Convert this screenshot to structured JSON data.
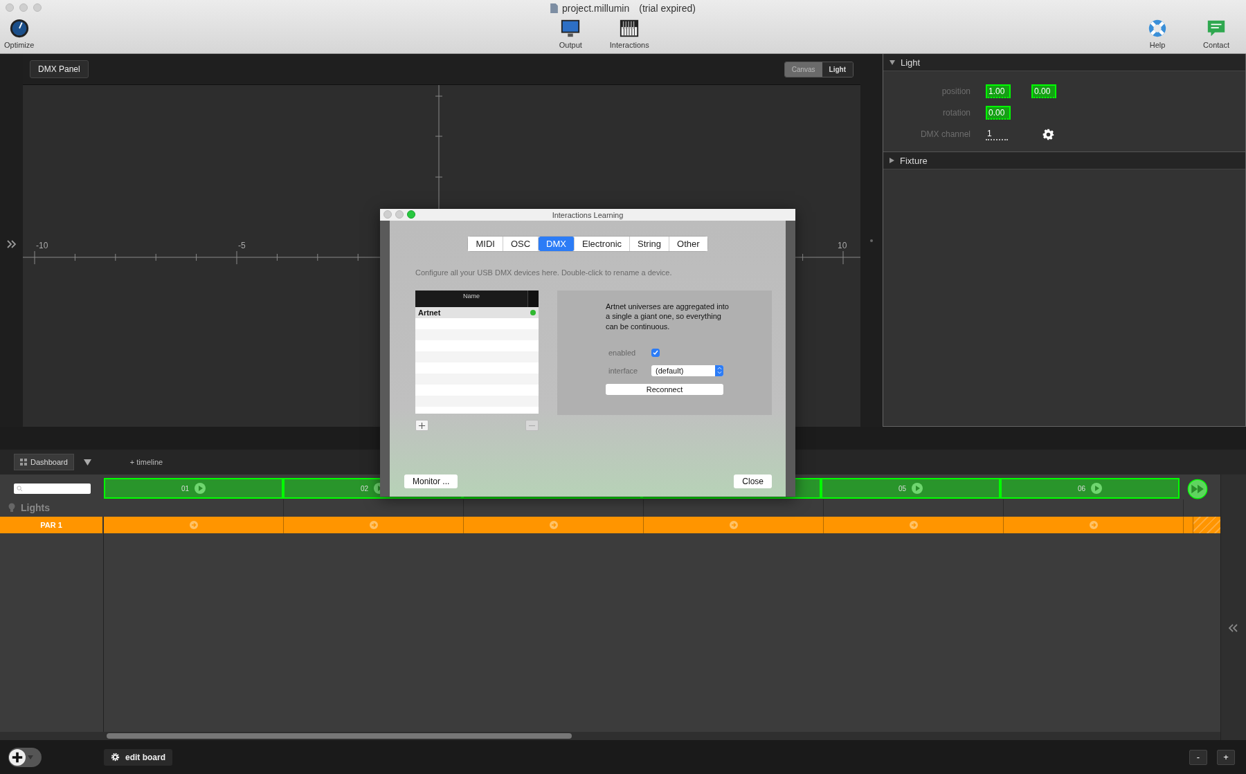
{
  "window": {
    "title": "project.millumin",
    "subtitle": "(trial expired)"
  },
  "toolbar": {
    "left": [
      {
        "label": "Optimize",
        "kind": "gauge"
      }
    ],
    "center": [
      {
        "label": "Output",
        "kind": "monitor"
      },
      {
        "label": "Interactions",
        "kind": "piano"
      }
    ],
    "right": [
      {
        "label": "Help",
        "kind": "lifebuoy"
      },
      {
        "label": "Contact",
        "kind": "chat"
      }
    ]
  },
  "canvas": {
    "panel_button": "DMX Panel",
    "modes": [
      {
        "label": "Canvas",
        "selected": false
      },
      {
        "label": "Light",
        "selected": true
      }
    ],
    "axis_labels": [
      "-10",
      "-5",
      "10"
    ]
  },
  "inspector": {
    "sections": [
      {
        "title": "Light",
        "expanded": true,
        "rows": [
          {
            "label": "position",
            "fields": [
              {
                "value": "1.00",
                "highlighted": true
              },
              {
                "value": "0.00",
                "highlighted": true
              }
            ]
          },
          {
            "label": "rotation",
            "fields": [
              {
                "value": "0.00",
                "highlighted": true
              }
            ]
          },
          {
            "label": "DMX channel",
            "fields": [
              {
                "value": "1",
                "highlighted": false
              }
            ],
            "settings": true
          }
        ]
      },
      {
        "title": "Fixture",
        "expanded": false
      }
    ]
  },
  "dashboard": {
    "tab": "Dashboard",
    "add_timeline": "+ timeline",
    "cues": [
      {
        "kind": "cue",
        "label": "01"
      },
      {
        "kind": "cue",
        "label": "02"
      },
      {
        "kind": "covered"
      },
      {
        "kind": "covered"
      },
      {
        "kind": "cue",
        "label": "05"
      },
      {
        "kind": "cue",
        "label": "06"
      }
    ],
    "layers": [
      {
        "label": "Lights",
        "kind": "group"
      },
      {
        "label": "PAR 1",
        "kind": "light"
      }
    ]
  },
  "bottom": {
    "edit_board": "edit board",
    "zoom_out": "-",
    "zoom_in": "+"
  },
  "dialog": {
    "title": "Interactions Learning",
    "tabs": [
      {
        "label": "MIDI",
        "selected": false
      },
      {
        "label": "OSC",
        "selected": false
      },
      {
        "label": "DMX",
        "selected": true
      },
      {
        "label": "Electronic",
        "selected": false
      },
      {
        "label": "String",
        "selected": false
      },
      {
        "label": "Other",
        "selected": false
      }
    ],
    "description": "Configure all your USB DMX devices here. Double-click to rename a device.",
    "devices_column": "Name",
    "devices": [
      {
        "name": "Artnet",
        "selected": true,
        "connected": true
      }
    ],
    "info": "Artnet universes are aggregated into a single a giant one, so everything can be continuous.",
    "enabled_label": "enabled",
    "enabled": true,
    "interface_label": "interface",
    "interface": "(default)",
    "reconnect": "Reconnect",
    "monitor": "Monitor ...",
    "close": "Close"
  }
}
